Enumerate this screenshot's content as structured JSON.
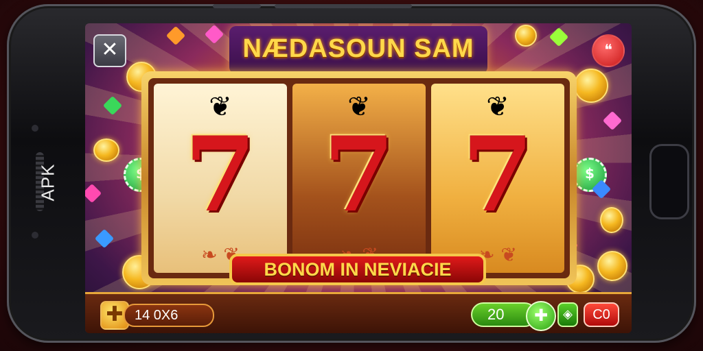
{
  "device": {
    "side_label": "APK"
  },
  "game": {
    "title": "NÆDASOUN SAM",
    "banner": "BONOM IN NEVIACIE",
    "reels": [
      {
        "symbol": "7"
      },
      {
        "symbol": "7"
      },
      {
        "symbol": "7"
      }
    ]
  },
  "controls": {
    "close_icon": "✕",
    "chat_icon": "chat-bubble-icon",
    "add_icon": "✚",
    "balance": "14  0X6",
    "bet": "20",
    "spin_icon": "✚",
    "auto_label": "◈",
    "max_label": "C0"
  },
  "colors": {
    "title": "#ffd84a",
    "seven": "#d6161c",
    "banner_bg": "#c81212",
    "bet_green": "#2aa010",
    "max_red": "#c81010"
  }
}
